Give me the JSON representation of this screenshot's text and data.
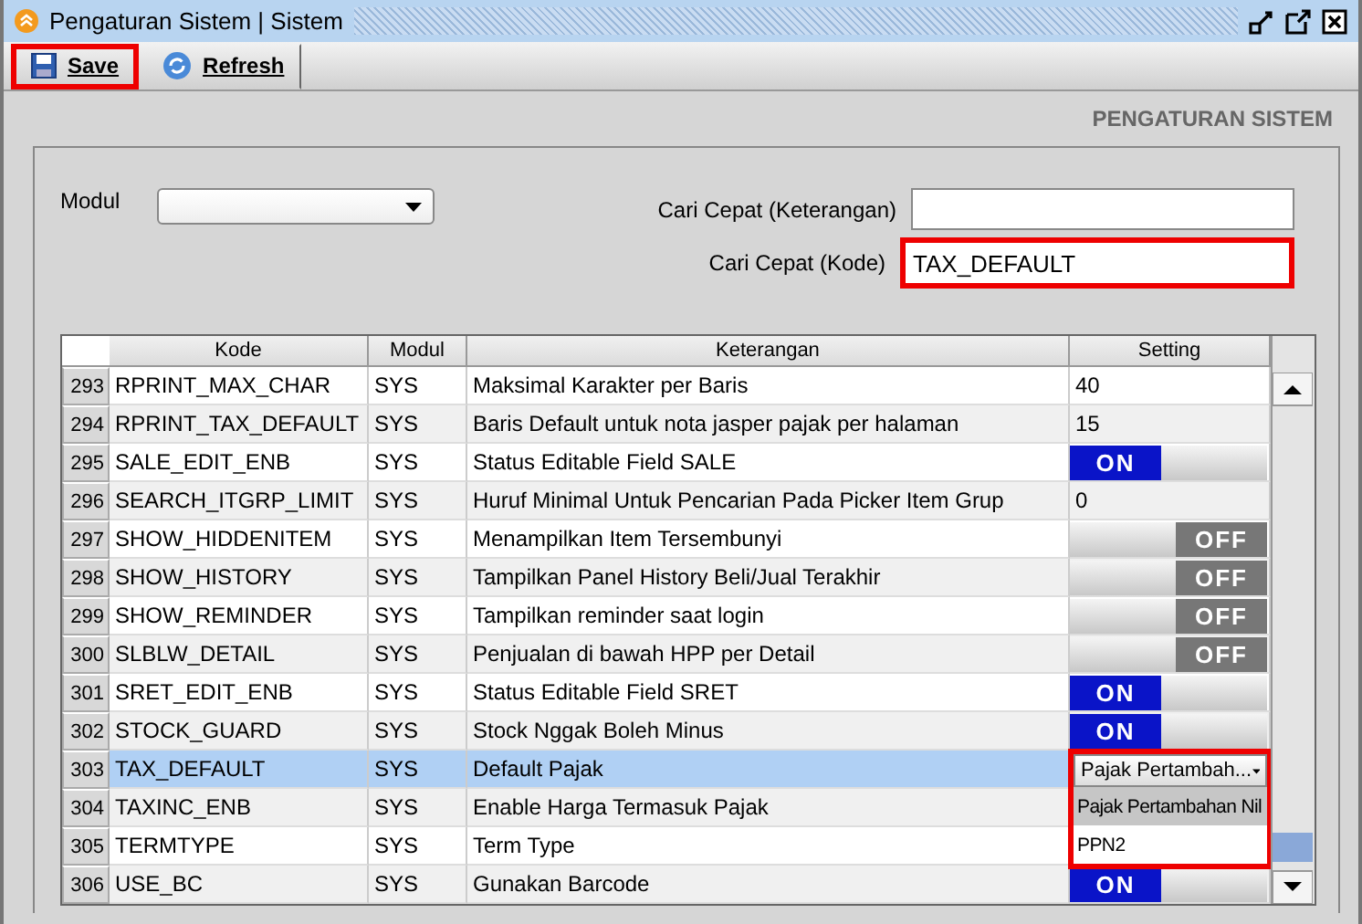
{
  "window": {
    "title": "Pengaturan Sistem | Sistem"
  },
  "toolbar": [
    {
      "label": "Save",
      "highlighted": true
    },
    {
      "label": "Refresh",
      "highlighted": false
    }
  ],
  "page_heading": "PENGATURAN SISTEM",
  "filters": {
    "modul_label": "Modul",
    "keterangan_label": "Cari Cepat (Keterangan)",
    "kode_label": "Cari Cepat (Kode)",
    "kode_value": "TAX_DEFAULT",
    "kode_highlighted": true
  },
  "table": {
    "columns": [
      "Kode",
      "Modul",
      "Keterangan",
      "Setting"
    ],
    "rows": [
      {
        "number": "293",
        "kode": "RPRINT_MAX_CHAR",
        "modul": "SYS",
        "keterangan": "Maksimal Karakter per Baris",
        "selected": false,
        "setting": {
          "kind": "text",
          "value": "40"
        }
      },
      {
        "number": "294",
        "kode": "RPRINT_TAX_DEFAULT",
        "modul": "SYS",
        "keterangan": "Baris Default untuk nota jasper pajak per halaman",
        "selected": false,
        "setting": {
          "kind": "text",
          "value": "15"
        }
      },
      {
        "number": "295",
        "kode": "SALE_EDIT_ENB",
        "modul": "SYS",
        "keterangan": "Status Editable Field SALE",
        "selected": false,
        "setting": {
          "kind": "toggle",
          "on": true,
          "label": "ON"
        }
      },
      {
        "number": "296",
        "kode": "SEARCH_ITGRP_LIMIT",
        "modul": "SYS",
        "keterangan": "Huruf Minimal Untuk Pencarian Pada Picker Item Grup",
        "selected": false,
        "setting": {
          "kind": "text",
          "value": "0"
        }
      },
      {
        "number": "297",
        "kode": "SHOW_HIDDENITEM",
        "modul": "SYS",
        "keterangan": "Menampilkan Item Tersembunyi",
        "selected": false,
        "setting": {
          "kind": "toggle",
          "on": false,
          "label": "OFF"
        }
      },
      {
        "number": "298",
        "kode": "SHOW_HISTORY",
        "modul": "SYS",
        "keterangan": "Tampilkan Panel History Beli/Jual Terakhir",
        "selected": false,
        "setting": {
          "kind": "toggle",
          "on": false,
          "label": "OFF"
        }
      },
      {
        "number": "299",
        "kode": "SHOW_REMINDER",
        "modul": "SYS",
        "keterangan": "Tampilkan reminder saat login",
        "selected": false,
        "setting": {
          "kind": "toggle",
          "on": false,
          "label": "OFF"
        }
      },
      {
        "number": "300",
        "kode": "SLBLW_DETAIL",
        "modul": "SYS",
        "keterangan": "Penjualan di bawah HPP per Detail",
        "selected": false,
        "setting": {
          "kind": "toggle",
          "on": false,
          "label": "OFF"
        }
      },
      {
        "number": "301",
        "kode": "SRET_EDIT_ENB",
        "modul": "SYS",
        "keterangan": "Status Editable Field SRET",
        "selected": false,
        "setting": {
          "kind": "toggle",
          "on": true,
          "label": "ON"
        }
      },
      {
        "number": "302",
        "kode": "STOCK_GUARD",
        "modul": "SYS",
        "keterangan": "Stock Nggak Boleh Minus",
        "selected": false,
        "setting": {
          "kind": "toggle",
          "on": true,
          "label": "ON"
        }
      },
      {
        "number": "303",
        "kode": "TAX_DEFAULT",
        "modul": "SYS",
        "keterangan": "Default Pajak",
        "selected": true,
        "setting": {
          "kind": "select",
          "value": "Pajak Pertambah...",
          "highlighted": true,
          "options": [
            {
              "label": "Pajak Pertambahan Nil",
              "selected": true
            },
            {
              "label": "PPN2",
              "selected": false
            }
          ]
        }
      },
      {
        "number": "304",
        "kode": "TAXINC_ENB",
        "modul": "SYS",
        "keterangan": "Enable Harga Termasuk Pajak",
        "selected": false,
        "setting": {
          "kind": "none"
        }
      },
      {
        "number": "305",
        "kode": "TERMTYPE",
        "modul": "SYS",
        "keterangan": "Term Type",
        "selected": false,
        "setting": {
          "kind": "none"
        }
      },
      {
        "number": "306",
        "kode": "USE_BC",
        "modul": "SYS",
        "keterangan": "Gunakan Barcode",
        "selected": false,
        "setting": {
          "kind": "toggle",
          "on": true,
          "label": "ON"
        }
      }
    ]
  }
}
